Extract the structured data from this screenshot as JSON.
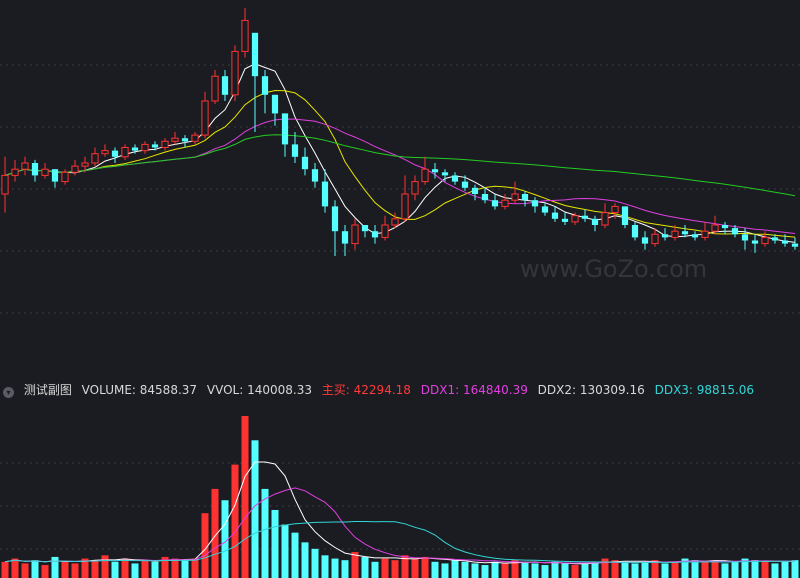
{
  "watermark": "www.GoZo.com",
  "sub_panel": {
    "collapse_icon": "chevron-down-icon",
    "title": "测试副图",
    "indicators": [
      {
        "label": "VOLUME: 84588.37",
        "color": "#d8d8d8"
      },
      {
        "label": "VVOL: 140008.33",
        "color": "#d8d8d8"
      },
      {
        "label": "主买: 42294.18",
        "color": "#ff3b3b"
      },
      {
        "label": "DDX1: 164840.39",
        "color": "#e040e0"
      },
      {
        "label": "DDX2: 130309.16",
        "color": "#d8d8d8"
      },
      {
        "label": "DDX3: 98815.06",
        "color": "#33d6d6"
      }
    ]
  },
  "colors": {
    "up": "#ff3232",
    "down": "#54ffff",
    "ma_short": "#ffffff",
    "ma_mid": "#e6e600",
    "ma_long": "#e040e0",
    "ma_longest": "#22cc22",
    "grid": "#3a3b44"
  },
  "chart_data": [
    {
      "type": "candlestick",
      "title": "",
      "ylim": [
        0,
        100
      ],
      "candles": [
        [
          40,
          46,
          52,
          34
        ],
        [
          46,
          48,
          51,
          44
        ],
        [
          48,
          50,
          52,
          46
        ],
        [
          50,
          46,
          51,
          44
        ],
        [
          46,
          48,
          50,
          45
        ],
        [
          48,
          44,
          48,
          42
        ],
        [
          44,
          47,
          48,
          43
        ],
        [
          47,
          49,
          51,
          46
        ],
        [
          49,
          50,
          52,
          47
        ],
        [
          50,
          53,
          55,
          49
        ],
        [
          53,
          54,
          56,
          52
        ],
        [
          54,
          52,
          55,
          50
        ],
        [
          52,
          55,
          56,
          51
        ],
        [
          55,
          54,
          56,
          53
        ],
        [
          54,
          56,
          57,
          53
        ],
        [
          56,
          55,
          57,
          54
        ],
        [
          55,
          57,
          58,
          54
        ],
        [
          57,
          58,
          60,
          56
        ],
        [
          58,
          57,
          59,
          55
        ],
        [
          57,
          59,
          60,
          56
        ],
        [
          59,
          70,
          73,
          58
        ],
        [
          70,
          78,
          80,
          69
        ],
        [
          78,
          72,
          80,
          70
        ],
        [
          72,
          86,
          88,
          70
        ],
        [
          86,
          96,
          100,
          84
        ],
        [
          92,
          78,
          84,
          60
        ],
        [
          78,
          72,
          80,
          66
        ],
        [
          72,
          66,
          72,
          62
        ],
        [
          66,
          56,
          66,
          52
        ],
        [
          56,
          52,
          60,
          50
        ],
        [
          52,
          48,
          55,
          46
        ],
        [
          48,
          44,
          50,
          42
        ],
        [
          44,
          36,
          48,
          34
        ],
        [
          36,
          28,
          38,
          20
        ],
        [
          28,
          24,
          30,
          20
        ],
        [
          24,
          30,
          32,
          22
        ],
        [
          30,
          28,
          30,
          26
        ],
        [
          28,
          26,
          30,
          24
        ],
        [
          26,
          30,
          33,
          25
        ],
        [
          30,
          32,
          34,
          29
        ],
        [
          32,
          40,
          46,
          31
        ],
        [
          40,
          44,
          46,
          38
        ],
        [
          44,
          48,
          52,
          43
        ],
        [
          48,
          47,
          50,
          45
        ],
        [
          47,
          46,
          48,
          44
        ],
        [
          46,
          44,
          47,
          43
        ],
        [
          44,
          42,
          46,
          41
        ],
        [
          42,
          40,
          43,
          38
        ],
        [
          40,
          38,
          42,
          37
        ],
        [
          38,
          36,
          40,
          35
        ],
        [
          36,
          38,
          40,
          35
        ],
        [
          38,
          40,
          44,
          37
        ],
        [
          40,
          38,
          41,
          36
        ],
        [
          38,
          36,
          39,
          34
        ],
        [
          36,
          34,
          37,
          33
        ],
        [
          34,
          32,
          36,
          31
        ],
        [
          32,
          31,
          34,
          30
        ],
        [
          31,
          33,
          34,
          30
        ],
        [
          33,
          32,
          35,
          31
        ],
        [
          32,
          30,
          33,
          28
        ],
        [
          30,
          34,
          37,
          29
        ],
        [
          34,
          36,
          37,
          32
        ],
        [
          36,
          30,
          36,
          29
        ],
        [
          30,
          26,
          31,
          25
        ],
        [
          26,
          24,
          28,
          22
        ],
        [
          24,
          27,
          29,
          23
        ],
        [
          27,
          26,
          29,
          25
        ],
        [
          26,
          28,
          30,
          25
        ],
        [
          28,
          27,
          30,
          26
        ],
        [
          27,
          26,
          28,
          25
        ],
        [
          26,
          28,
          31,
          25
        ],
        [
          28,
          30,
          33,
          27
        ],
        [
          30,
          29,
          31,
          27
        ],
        [
          29,
          27,
          30,
          26
        ],
        [
          27,
          25,
          29,
          22
        ],
        [
          25,
          24,
          27,
          21
        ],
        [
          24,
          26,
          28,
          23
        ],
        [
          26,
          25,
          27,
          24
        ],
        [
          25,
          24,
          27,
          23
        ],
        [
          24,
          23,
          26,
          22
        ]
      ],
      "ma_periods": [
        5,
        10,
        20,
        60
      ]
    },
    {
      "type": "bar",
      "title": "",
      "ylim": [
        0,
        100
      ],
      "volumes": [
        10,
        12,
        9,
        11,
        8,
        13,
        10,
        9,
        12,
        11,
        14,
        10,
        12,
        9,
        11,
        10,
        13,
        12,
        11,
        12,
        40,
        55,
        48,
        70,
        100,
        85,
        55,
        42,
        33,
        28,
        22,
        18,
        14,
        12,
        11,
        16,
        13,
        10,
        12,
        11,
        14,
        12,
        13,
        10,
        9,
        11,
        10,
        9,
        8,
        10,
        9,
        11,
        10,
        9,
        8,
        10,
        9,
        8,
        9,
        10,
        12,
        11,
        10,
        9,
        10,
        11,
        9,
        10,
        12,
        11,
        10,
        11,
        9,
        10,
        12,
        11,
        10,
        9,
        10,
        11
      ],
      "overlay_periods": [
        5,
        10,
        20
      ]
    }
  ]
}
